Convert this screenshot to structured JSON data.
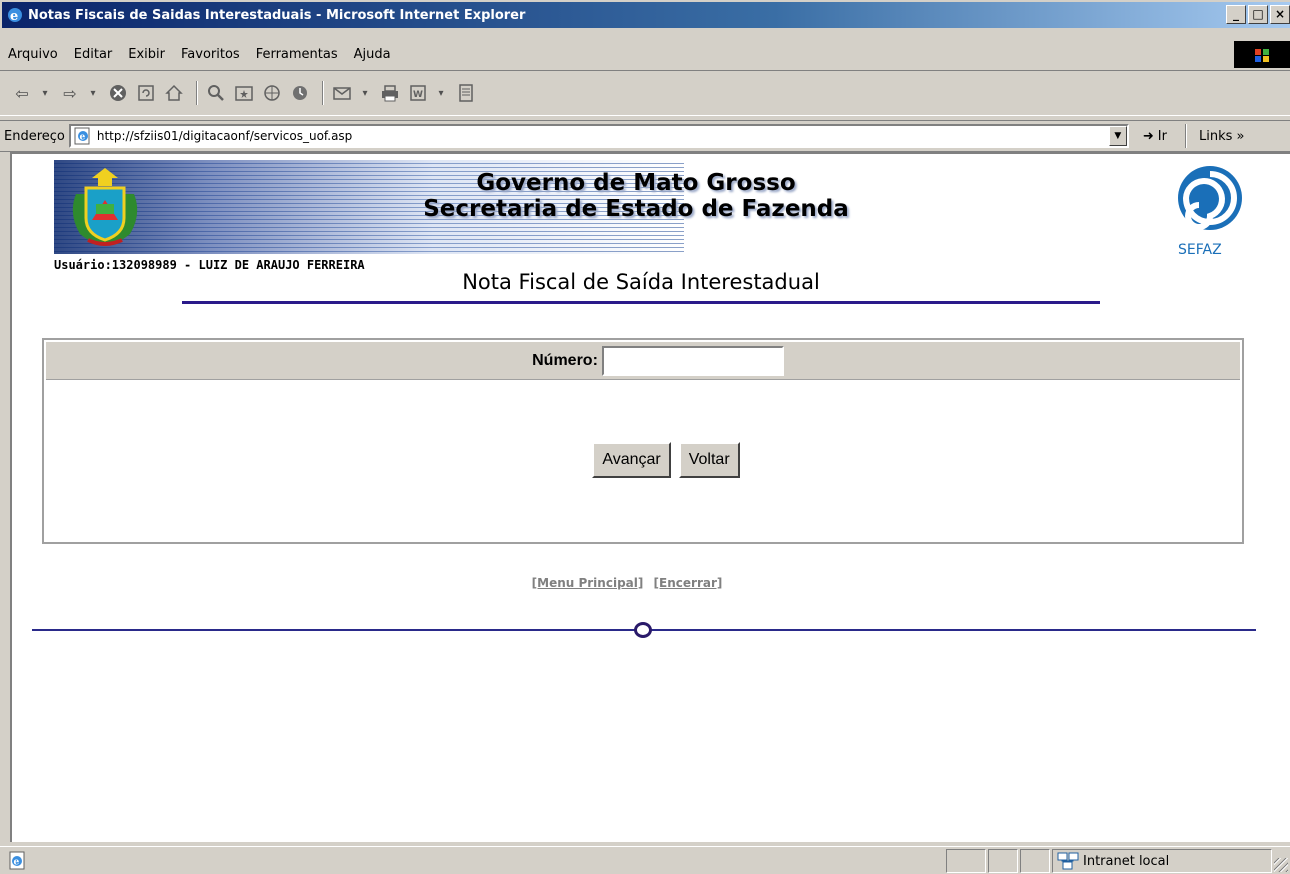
{
  "window": {
    "title": "Notas Fiscais de Saidas Interestaduais - Microsoft Internet Explorer",
    "minimize": "_",
    "maximize": "□",
    "close": "×"
  },
  "menu": {
    "items": [
      "Arquivo",
      "Editar",
      "Exibir",
      "Favoritos",
      "Ferramentas",
      "Ajuda"
    ]
  },
  "address": {
    "label": "Endereço",
    "url": "http://sfziis01/digitacaonf/servicos_uof.asp",
    "go_label": "Ir",
    "links_label": "Links »"
  },
  "header": {
    "title_line1": "Governo de Mato Grosso",
    "title_line2": "Secretaria de Estado de Fazenda",
    "logo_text": "SEFAZ",
    "user": "Usuário:132098989 - LUIZ DE ARAUJO FERREIRA",
    "page_title": "Nota Fiscal de Saída Interestadual"
  },
  "form": {
    "numero_label": "Número:",
    "numero_value": "",
    "advance_label": "Avançar",
    "back_label": "Voltar"
  },
  "footer_links": {
    "menu_principal": "[Menu Principal]",
    "encerrar": "[Encerrar]"
  },
  "status": {
    "zone": "Intranet local"
  },
  "colors": {
    "titlebar_start": "#0a246a",
    "rule": "#2a1a8a",
    "sefaz_blue": "#1a6fb8"
  }
}
